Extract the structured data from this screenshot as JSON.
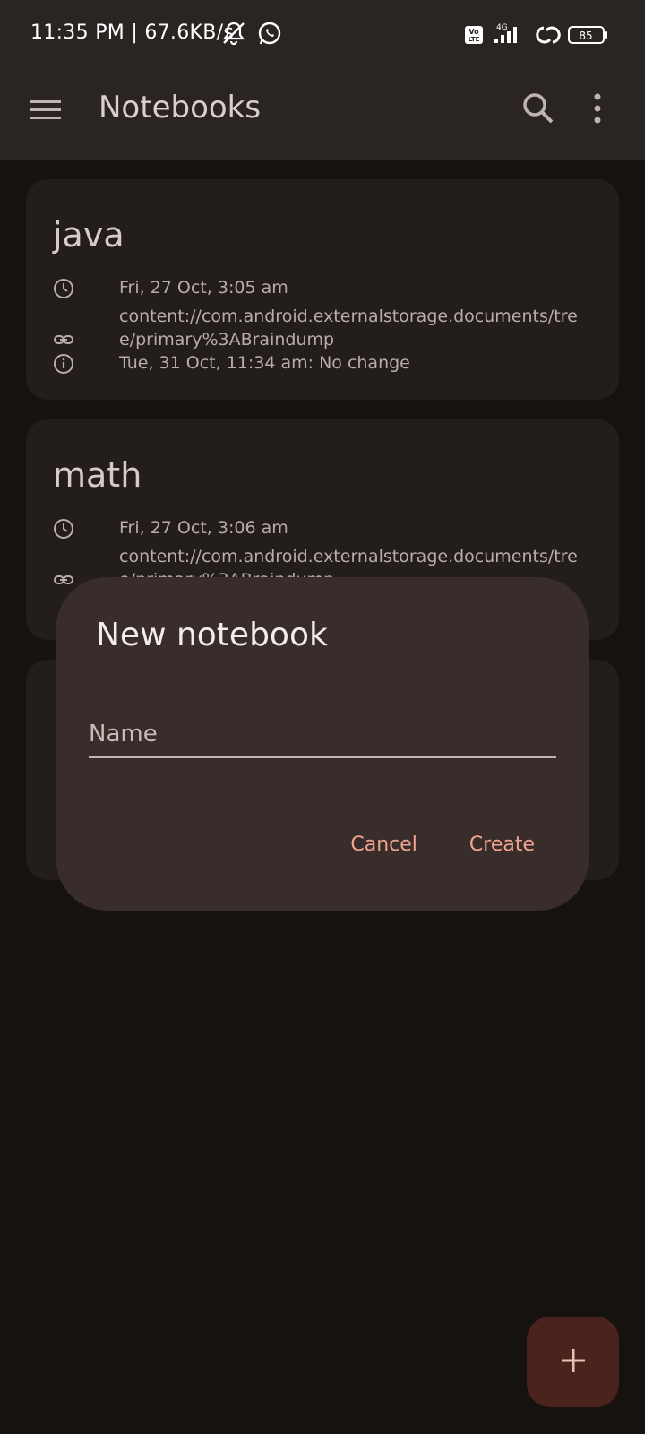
{
  "status_bar": {
    "time": "11:35 PM | 67.6KB/s",
    "battery_level": "85",
    "network": "4G",
    "volte": "Vo LTE",
    "icons": [
      "bell-muted-icon",
      "whatsapp-icon",
      "volte-icon",
      "signal-icon",
      "data-saver-icon",
      "battery-icon"
    ]
  },
  "app_bar": {
    "title": "Notebooks",
    "icons": [
      "menu-icon",
      "search-icon",
      "more-vert-icon"
    ]
  },
  "notebooks": [
    {
      "name": "java",
      "created": "Fri, 27 Oct, 3:05 am",
      "uri": "content://com.android.externalstorage.documents/tree/primary%3ABraindump",
      "sync": "Tue, 31 Oct, 11:34 am: No change"
    },
    {
      "name": "math",
      "created": "Fri, 27 Oct, 3:06 am",
      "uri": "content://com.android.externalstorage.documents/tree/primary%3ABraindump"
    }
  ],
  "dialog": {
    "title": "New notebook",
    "name_placeholder": "Name",
    "name_value": "",
    "cancel_label": "Cancel",
    "create_label": "Create"
  },
  "fab": {
    "icon": "plus-icon"
  },
  "colors": {
    "background": "#151210",
    "bar": "#2a2422",
    "card": "#231d1b",
    "dialog": "#382d2b",
    "accent": "#f0a48f",
    "fab": "#4a231c"
  }
}
